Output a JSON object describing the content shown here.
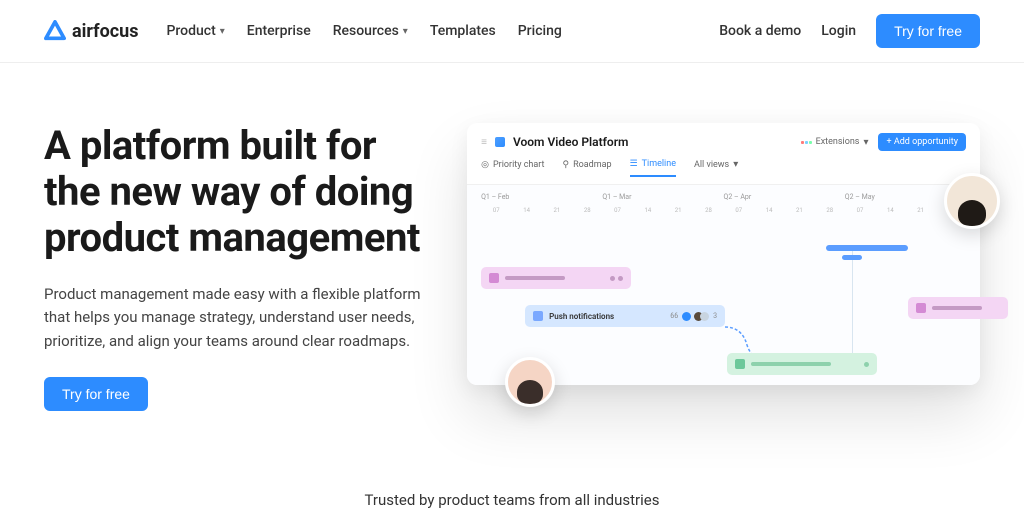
{
  "header": {
    "logo": "airfocus",
    "nav": [
      {
        "label": "Product",
        "hasDropdown": true
      },
      {
        "label": "Enterprise",
        "hasDropdown": false
      },
      {
        "label": "Resources",
        "hasDropdown": true
      },
      {
        "label": "Templates",
        "hasDropdown": false
      },
      {
        "label": "Pricing",
        "hasDropdown": false
      }
    ],
    "demo": "Book a demo",
    "login": "Login",
    "cta": "Try for free"
  },
  "hero": {
    "title": "A platform built for the new way of doing product management",
    "subtitle": "Product management made easy with a flexible platform that helps you manage strategy, understand user needs, prioritize, and align your teams around clear roadmaps.",
    "cta": "Try for free"
  },
  "app": {
    "workspace": "Voom Video Platform",
    "extensions": "Extensions",
    "addBtn": "+ Add opportunity",
    "tabs": {
      "priority": "Priority chart",
      "roadmap": "Roadmap",
      "timeline": "Timeline",
      "allviews": "All views"
    },
    "months": [
      "Q1 – Feb",
      "Q1 – Mar",
      "Q2 – Apr",
      "Q2 – May"
    ],
    "days": [
      "07",
      "14",
      "21",
      "28",
      "07",
      "14",
      "21",
      "28",
      "07",
      "14",
      "21",
      "28",
      "07",
      "14",
      "21",
      "28"
    ],
    "cardLabel": "Push notifications",
    "chipCount1": "66",
    "chipCount2": "3"
  },
  "proof": "Trusted by product teams from all industries"
}
